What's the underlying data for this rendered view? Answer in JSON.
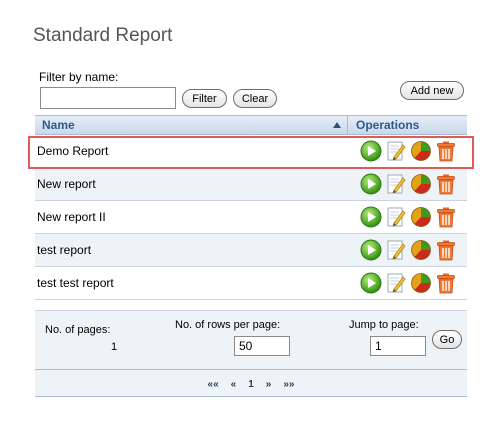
{
  "page": {
    "title": "Standard Report"
  },
  "filter": {
    "label": "Filter by name:",
    "value": "",
    "filter_button": "Filter",
    "clear_button": "Clear"
  },
  "toolbar": {
    "add_new_button": "Add new"
  },
  "grid": {
    "columns": {
      "name": "Name",
      "operations": "Operations"
    },
    "rows": [
      {
        "name": "Demo Report"
      },
      {
        "name": "New report"
      },
      {
        "name": "New report II"
      },
      {
        "name": "test report"
      },
      {
        "name": "test test report"
      }
    ],
    "operation_icons": [
      "play-icon",
      "edit-icon",
      "pie-chart-icon",
      "trash-icon"
    ]
  },
  "pager": {
    "pages_label": "No. of pages:",
    "pages_value": "1",
    "rows_label": "No. of rows per page:",
    "rows_value": "50",
    "jump_label": "Jump to page:",
    "jump_value": "1",
    "go_button": "Go",
    "nav": {
      "first": "««",
      "prev": "«",
      "current": "1",
      "next": "»",
      "last": "»»"
    }
  },
  "colors": {
    "header_text": "#2f5a8f",
    "row_alt": "#eef3f8",
    "highlight": "#e05a5a"
  }
}
